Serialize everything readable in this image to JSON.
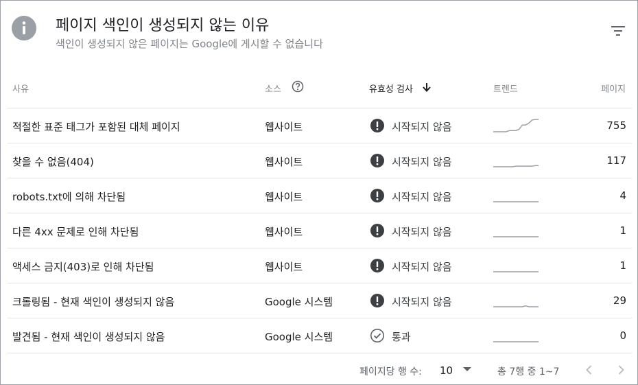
{
  "header": {
    "title": "페이지 색인이 생성되지 않는 이유",
    "subtitle": "색인이 생성되지 않은 페이지는 Google에 게시할 수 없습니다",
    "info_icon": "info-icon",
    "filter_icon": "filter-icon"
  },
  "table": {
    "columns": {
      "reason": "사유",
      "source": "소스",
      "validation": "유효성 검사",
      "trend": "트렌드",
      "pages": "페이지"
    },
    "rows": [
      {
        "reason": "적절한 표준 태그가 포함된 대체 페이지",
        "source": "웹사이트",
        "status": "시작되지 않음",
        "status_icon": "alert-icon",
        "pages": "755",
        "trend": [
          0,
          0,
          0,
          0,
          0,
          0.1,
          0.1,
          0.1,
          0.2,
          0.55,
          0.55,
          0.7,
          0.95,
          1,
          1
        ]
      },
      {
        "reason": "찾을 수 없음(404)",
        "source": "웹사이트",
        "status": "시작되지 않음",
        "status_icon": "alert-icon",
        "pages": "117",
        "trend": [
          0,
          0,
          0,
          0,
          0,
          0,
          0,
          0.05,
          0.05,
          0.05,
          0.05,
          0.05,
          0.05,
          0.1,
          0.1
        ]
      },
      {
        "reason": "robots.txt에 의해 차단됨",
        "source": "웹사이트",
        "status": "시작되지 않음",
        "status_icon": "alert-icon",
        "pages": "4",
        "trend": [
          0,
          0,
          0,
          0,
          0,
          0,
          0,
          0,
          0,
          0,
          0,
          0,
          0,
          0,
          0
        ]
      },
      {
        "reason": "다른 4xx 문제로 인해 차단됨",
        "source": "웹사이트",
        "status": "시작되지 않음",
        "status_icon": "alert-icon",
        "pages": "1",
        "trend": [
          0,
          0,
          0,
          0,
          0,
          0,
          0,
          0,
          0,
          0,
          0,
          0,
          0,
          0,
          0
        ]
      },
      {
        "reason": "액세스 금지(403)로 인해 차단됨",
        "source": "웹사이트",
        "status": "시작되지 않음",
        "status_icon": "alert-icon",
        "pages": "1",
        "trend": [
          0,
          0,
          0,
          0,
          0,
          0,
          0,
          0,
          0,
          0,
          0,
          0,
          0,
          0,
          0
        ]
      },
      {
        "reason": "크롤링됨 - 현재 색인이 생성되지 않음",
        "source": "Google 시스템",
        "status": "시작되지 않음",
        "status_icon": "alert-icon",
        "pages": "29",
        "trend": [
          0,
          0,
          0,
          0,
          0,
          0,
          0,
          0,
          0,
          0,
          0.08,
          0,
          0,
          0,
          0
        ]
      },
      {
        "reason": "발견됨 - 현재 색인이 생성되지 않음",
        "source": "Google 시스템",
        "status": "통과",
        "status_icon": "check-circle-icon",
        "pages": "0",
        "trend": [
          0,
          0,
          0,
          0,
          0,
          0,
          0,
          0,
          0,
          0,
          0,
          0,
          0,
          0,
          0
        ]
      }
    ]
  },
  "footer": {
    "rows_per_page_label": "페이지당 행 수:",
    "rows_per_page_value": "10",
    "range_text": "총 7행 중 1~7"
  },
  "colors": {
    "alert": "#3c4043",
    "pass": "#5f6368",
    "sparkline": "#9aa0a6",
    "border": "#e0e3e7"
  }
}
